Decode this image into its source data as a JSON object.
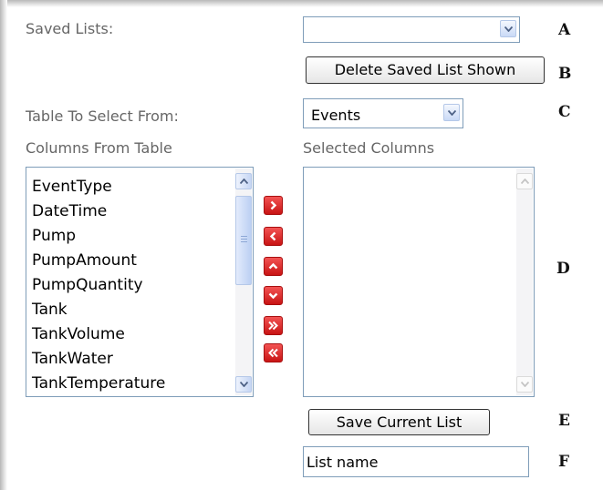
{
  "labels": {
    "saved_lists": "Saved Lists:",
    "table_to_select": "Table To Select From:",
    "columns_from_table": "Columns From Table",
    "selected_columns": "Selected Columns"
  },
  "saved_lists_select": {
    "value": ""
  },
  "table_select": {
    "value": "Events"
  },
  "buttons": {
    "delete_saved_list": "Delete Saved List Shown",
    "save_current_list": "Save Current List"
  },
  "columns_list": {
    "items": [
      "EventType",
      "DateTime",
      "Pump",
      "PumpAmount",
      "PumpQuantity",
      "Tank",
      "TankVolume",
      "TankWater",
      "TankTemperature"
    ]
  },
  "selected_columns_list": {
    "items": []
  },
  "move_buttons": [
    {
      "action": "add-selected",
      "icon": "chevron-right-icon"
    },
    {
      "action": "remove-selected",
      "icon": "chevron-left-icon"
    },
    {
      "action": "move-up",
      "icon": "chevron-up-icon"
    },
    {
      "action": "move-down",
      "icon": "chevron-down-icon"
    },
    {
      "action": "add-all",
      "icon": "double-chevron-right-icon"
    },
    {
      "action": "remove-all",
      "icon": "double-chevron-left-icon"
    }
  ],
  "list_name_input": {
    "value": "List name"
  },
  "annotations": {
    "a": "A",
    "b": "B",
    "c": "C",
    "d": "D",
    "e": "E",
    "f": "F"
  },
  "colors": {
    "button_red": "#d9261c",
    "label_gray": "#666666",
    "border_blue": "#7f9db9"
  }
}
